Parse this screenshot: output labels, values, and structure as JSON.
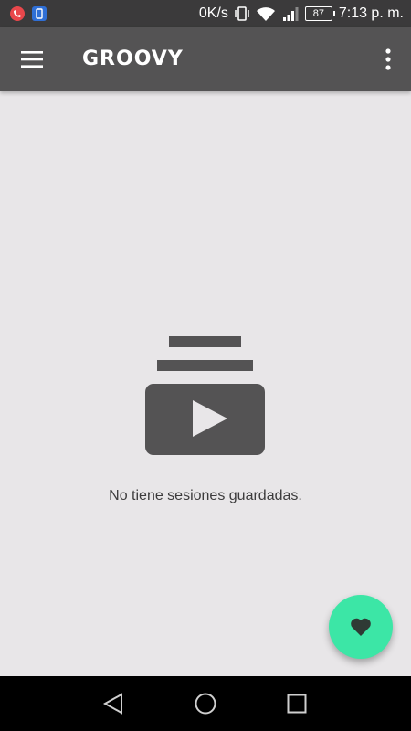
{
  "status_bar": {
    "speed": "0K/s",
    "battery": "87",
    "time": "7:13 p. m."
  },
  "app_bar": {
    "title": "GROOVY",
    "icons": {
      "menu": "hamburger-menu-icon",
      "overflow": "more-vertical-icon"
    }
  },
  "empty_state": {
    "icon": "video-library-icon",
    "message": "No tiene sesiones guardadas."
  },
  "fab": {
    "icon": "heart-icon",
    "color": "#3ce6a6"
  },
  "nav_bar": {
    "icons": [
      "back-triangle-icon",
      "home-circle-icon",
      "recents-square-icon"
    ]
  },
  "colors": {
    "app_bar": "#545354",
    "status_bar": "#3b3a3b",
    "background": "#e8e6e8",
    "illustration": "#545354",
    "accent": "#3ce6a6"
  }
}
